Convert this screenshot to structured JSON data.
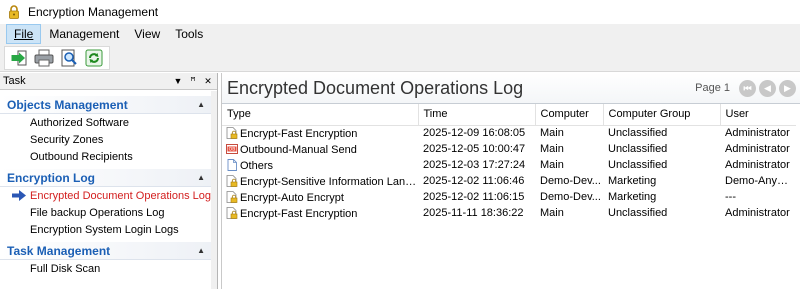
{
  "window": {
    "title": "Encryption Management"
  },
  "menu": [
    {
      "label": "File",
      "active": true
    },
    {
      "label": "Management",
      "active": false
    },
    {
      "label": "View",
      "active": false
    },
    {
      "label": "Tools",
      "active": false
    }
  ],
  "toolbar": {
    "icons": [
      "login-icon",
      "print-icon",
      "print-preview-icon",
      "refresh-icon"
    ]
  },
  "taskpane": {
    "title": "Task",
    "groups": [
      {
        "label": "Objects Management",
        "items": [
          {
            "label": "Authorized Software",
            "selected": false
          },
          {
            "label": "Security Zones",
            "selected": false
          },
          {
            "label": "Outbound Recipients",
            "selected": false
          }
        ]
      },
      {
        "label": "Encryption Log",
        "items": [
          {
            "label": "Encrypted Document Operations Log",
            "selected": true
          },
          {
            "label": "File backup Operations Log",
            "selected": false
          },
          {
            "label": "Encryption System Login Logs",
            "selected": false
          }
        ]
      },
      {
        "label": "Task Management",
        "items": [
          {
            "label": "Full Disk Scan",
            "selected": false
          }
        ]
      }
    ]
  },
  "main": {
    "title": "Encrypted Document Operations Log",
    "pager": {
      "page_label": "Page 1"
    },
    "columns": [
      "Type",
      "Time",
      "Computer",
      "Computer Group",
      "User"
    ],
    "rows": [
      {
        "icon": "lock-document-icon",
        "type": "Encrypt-Fast Encryption",
        "time": "2025-12-09 16:08:05",
        "computer": "Main",
        "group": "Unclassified",
        "user": "Administrator"
      },
      {
        "icon": "outbound-send-icon",
        "type": "Outbound-Manual Send",
        "time": "2025-12-05 10:00:47",
        "computer": "Main",
        "group": "Unclassified",
        "user": "Administrator"
      },
      {
        "icon": "document-icon",
        "type": "Others",
        "time": "2025-12-03 17:27:24",
        "computer": "Main",
        "group": "Unclassified",
        "user": "Administrator"
      },
      {
        "icon": "lock-document-icon",
        "type": "Encrypt-Sensitive Information Landing...",
        "time": "2025-12-02 11:06:46",
        "computer": "Demo-Dev...",
        "group": "Marketing",
        "user": "Demo-AnySec..."
      },
      {
        "icon": "lock-document-icon",
        "type": "Encrypt-Auto Encrypt",
        "time": "2025-12-02 11:06:15",
        "computer": "Demo-Dev...",
        "group": "Marketing",
        "user": "---"
      },
      {
        "icon": "lock-document-icon",
        "type": "Encrypt-Fast Encryption",
        "time": "2025-11-11 18:36:22",
        "computer": "Main",
        "group": "Unclassified",
        "user": "Administrator"
      }
    ]
  },
  "colors": {
    "group_header": "#1b5fb5",
    "selected_item": "#d31f1f",
    "menu_active_bg": "#cce4f7"
  }
}
